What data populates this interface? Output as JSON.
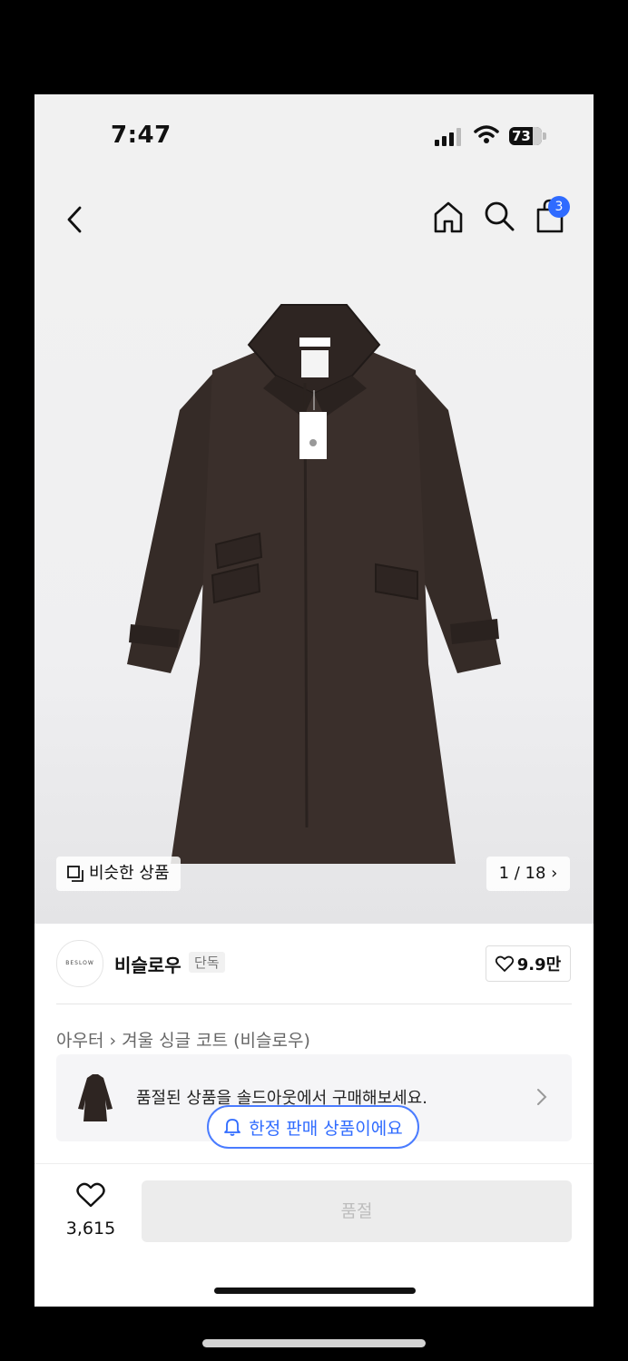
{
  "status_bar": {
    "time": "7:47",
    "battery": "73"
  },
  "nav": {
    "cart_count": "3"
  },
  "image": {
    "similar_label": "비슷한 상품",
    "pager": "1 / 18 ›"
  },
  "brand": {
    "logo_text": "BESLOW",
    "name": "비슬로우",
    "tag": "단독",
    "likes": "9.9만"
  },
  "product": {
    "breadcrumb": "아우터 › 겨울 싱글 코트 (비슬로우)",
    "soldout_message": "품절된 상품을 솔드아웃에서 구매해보세요.",
    "limited_label": "한정 판매 상품이에요"
  },
  "bottom": {
    "like_count": "3,615",
    "button_label": "품절"
  },
  "colors": {
    "accent": "#2f6bff",
    "coat": "#3a2f2b"
  }
}
